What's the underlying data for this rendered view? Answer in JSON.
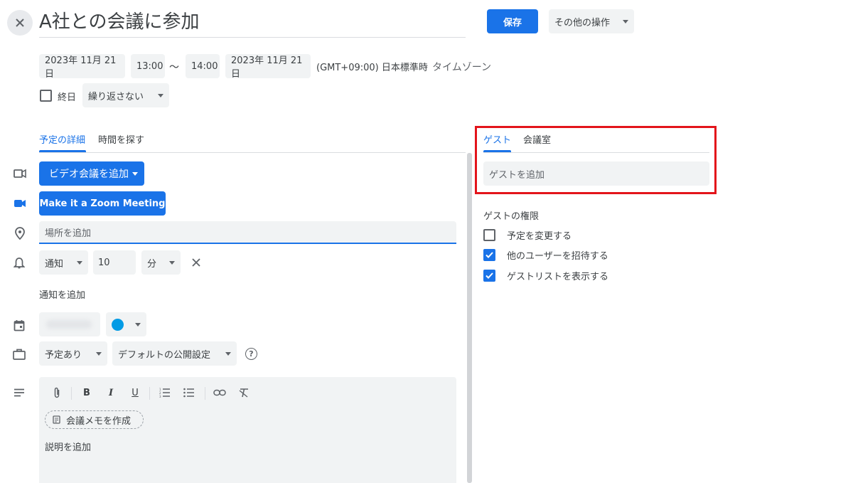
{
  "header": {
    "title": "A社との会議に参加",
    "save_label": "保存",
    "more_actions_label": "その他の操作"
  },
  "datetime": {
    "start_date": "2023年 11月 21日",
    "start_time": "13:00",
    "separator": "〜",
    "end_time": "14:00",
    "end_date": "2023年 11月 21日",
    "timezone_value": "(GMT+09:00) 日本標準時",
    "timezone_link": "タイムゾーン",
    "all_day_label": "終日",
    "repeat_value": "繰り返さない"
  },
  "tabs": {
    "details": "予定の詳細",
    "find_time": "時間を探す"
  },
  "details": {
    "video_button": "ビデオ会議を追加",
    "zoom_button": "Make it a Zoom Meeting",
    "location_placeholder": "場所を追加",
    "notification_type": "通知",
    "notification_value": "10",
    "notification_unit": "分",
    "add_notification": "通知を追加",
    "calendar_color": "#039be5",
    "status_value": "予定あり",
    "visibility_value": "デフォルトの公開設定",
    "meeting_notes": "会議メモを作成",
    "description_placeholder": "説明を追加"
  },
  "guests_panel": {
    "tab_guests": "ゲスト",
    "tab_rooms": "会議室",
    "add_guest_placeholder": "ゲストを追加",
    "permissions_title": "ゲストの権限",
    "permissions": [
      {
        "label": "予定を変更する",
        "checked": false
      },
      {
        "label": "他のユーザーを招待する",
        "checked": true
      },
      {
        "label": "ゲストリストを表示する",
        "checked": true
      }
    ]
  },
  "colors": {
    "accent": "#1a73e8",
    "highlight": "#e3141b"
  }
}
